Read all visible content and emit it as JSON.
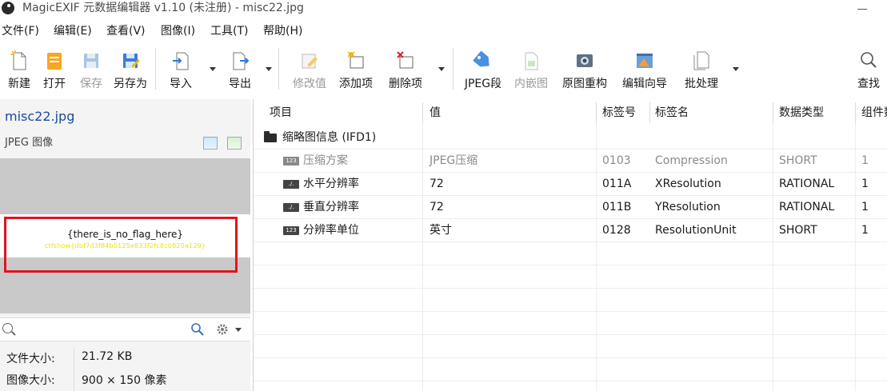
{
  "window": {
    "title": "MagicEXIF 元数据编辑器 v1.10 (未注册) - misc22.jpg"
  },
  "menu": [
    "文件(F)",
    "编辑(E)",
    "查看(V)",
    "图像(I)",
    "工具(T)",
    "帮助(H)"
  ],
  "toolbar": {
    "new": "新建",
    "open": "打开",
    "save": "保存",
    "save_as": "另存为",
    "import": "导入",
    "export": "导出",
    "modify": "修改值",
    "add_item": "添加项",
    "delete_item": "删除项",
    "jpeg_segment": "JPEG段",
    "embedded_image": "内嵌图",
    "rebuild": "原图重构",
    "wizard": "编辑向导",
    "batch": "批处理",
    "find": "查找"
  },
  "left_panel": {
    "filename": "misc22.jpg",
    "filetype": "JPEG 图像",
    "preview_line1": "{there_is_no_flag_here}",
    "preview_line2": "ctfshow{dbf7d3f84b0125e833f2fc8c0820a129}",
    "search_placeholder": "",
    "info": [
      {
        "key": "文件大小:",
        "value": "21.72 KB"
      },
      {
        "key": "图像大小:",
        "value": "900 × 150 像素"
      }
    ]
  },
  "table": {
    "columns": [
      "项目",
      "值",
      "标签号",
      "标签名",
      "数据类型",
      "组件数"
    ],
    "group": "缩略图信息 (IFD1)",
    "rows": [
      {
        "item": "压缩方案",
        "value": "JPEG压缩",
        "tag": "0103",
        "name": "Compression",
        "type": "SHORT",
        "count": "1",
        "badge": "123",
        "dim": true
      },
      {
        "item": "水平分辨率",
        "value": "72",
        "tag": "011A",
        "name": "XResolution",
        "type": "RATIONAL",
        "count": "1",
        "badge": "./.",
        "dim": false
      },
      {
        "item": "垂直分辨率",
        "value": "72",
        "tag": "011B",
        "name": "YResolution",
        "type": "RATIONAL",
        "count": "1",
        "badge": "./.",
        "dim": false
      },
      {
        "item": "分辨率单位",
        "value": "英寸",
        "tag": "0128",
        "name": "ResolutionUnit",
        "type": "SHORT",
        "count": "1",
        "badge": "123",
        "dim": false
      }
    ]
  }
}
